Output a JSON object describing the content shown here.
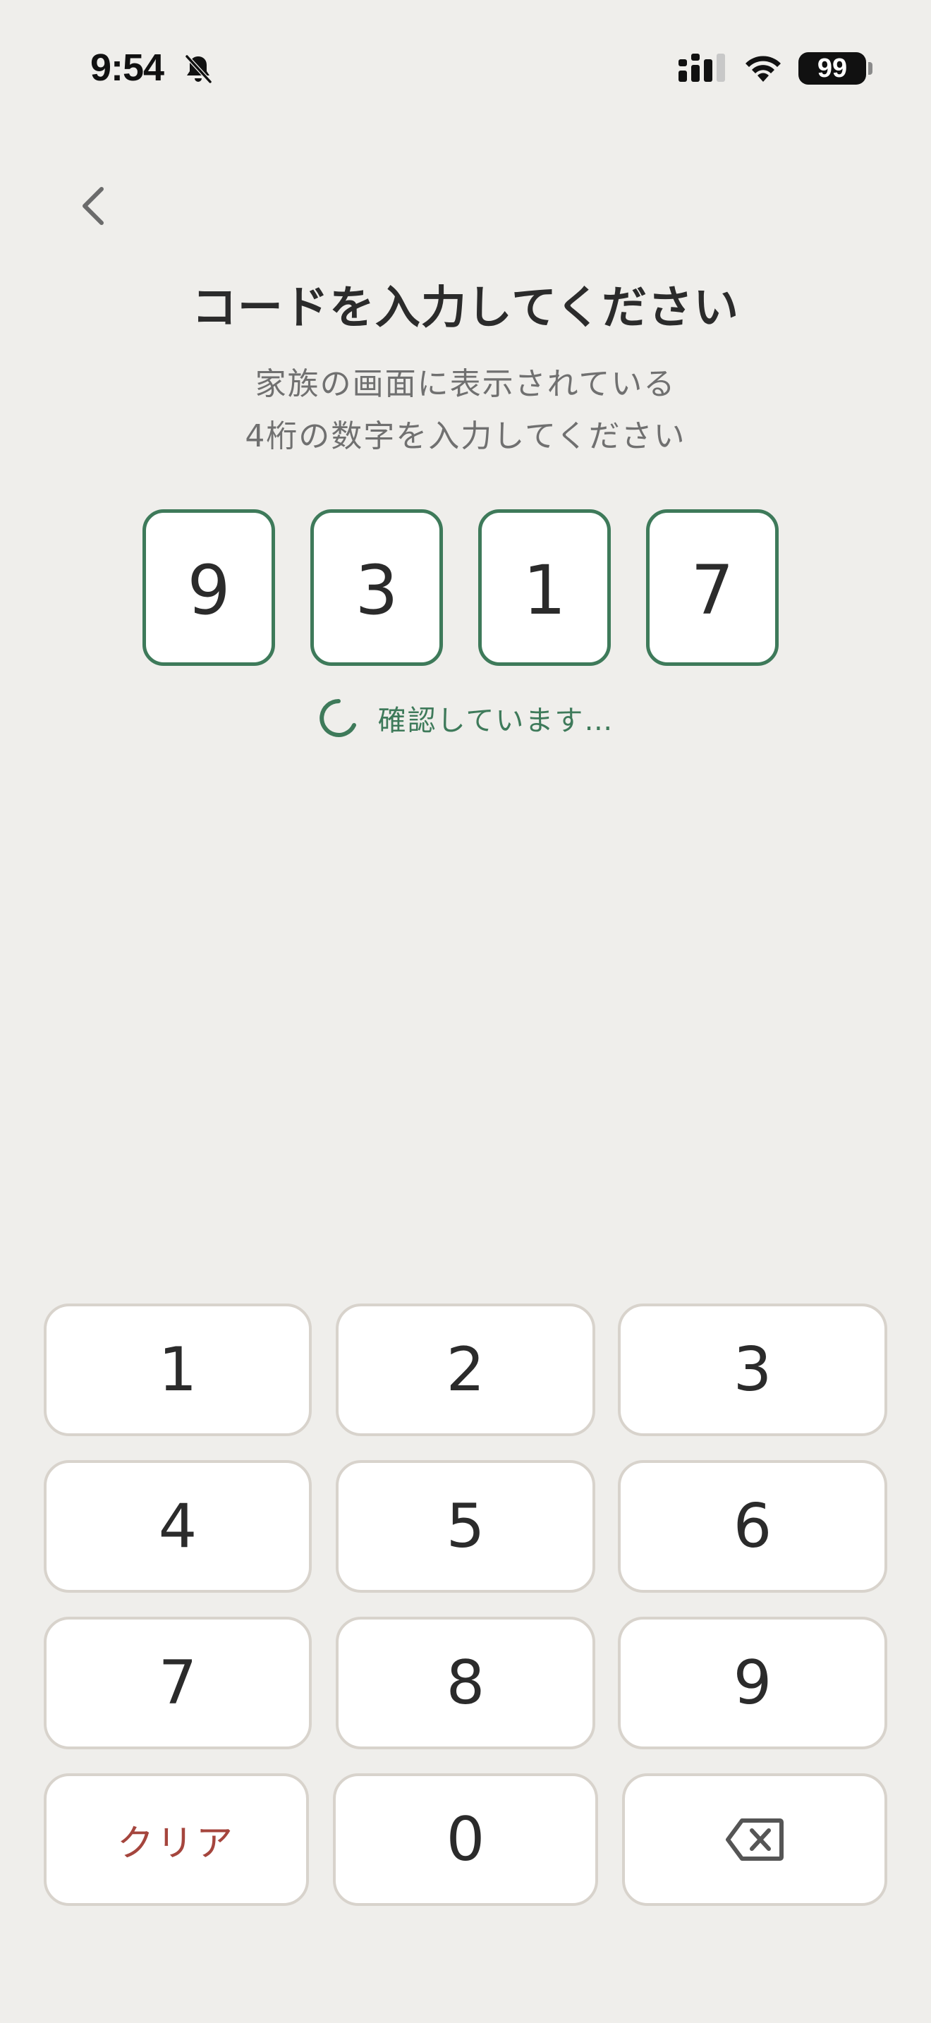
{
  "status_bar": {
    "time": "9:54",
    "battery": "99",
    "icons": [
      "bell-slash-icon",
      "signal-icon",
      "wifi-icon",
      "battery-icon"
    ]
  },
  "header": {
    "back_icon": "chevron-left-icon",
    "title": "コードを入力してください",
    "subtitle_line1": "家族の画面に表示されている",
    "subtitle_line2": "4桁の数字を入力してください"
  },
  "code": {
    "digits": [
      "9",
      "3",
      "1",
      "7"
    ]
  },
  "status": {
    "text": "確認しています…",
    "icon": "spinner-icon"
  },
  "keypad": {
    "keys": [
      "1",
      "2",
      "3",
      "4",
      "5",
      "6",
      "7",
      "8",
      "9"
    ],
    "clear_label": "クリア",
    "zero": "0",
    "backspace_icon": "backspace-icon"
  },
  "colors": {
    "background": "#efeeeb",
    "accent": "#3e7a5a",
    "clear": "#a5453d",
    "key_border": "#d8d3cc"
  }
}
